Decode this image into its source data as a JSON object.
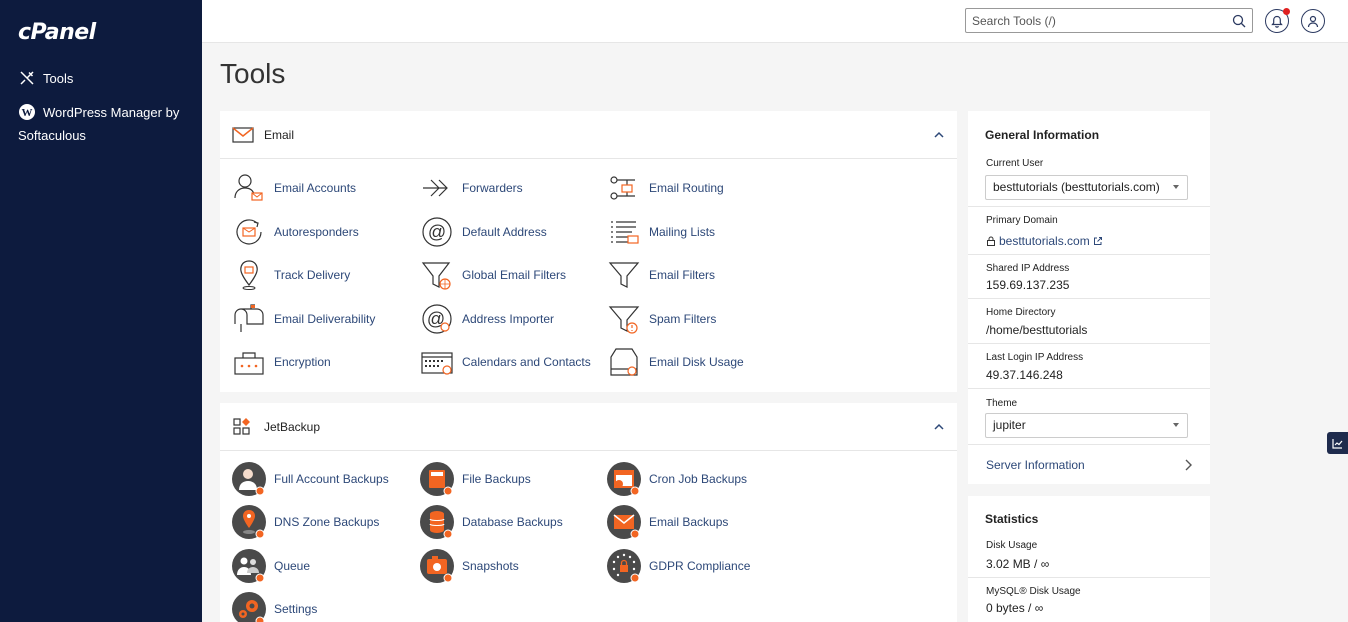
{
  "brand": {
    "logo": "cPanel"
  },
  "sidebar": {
    "items": [
      {
        "label": "Tools",
        "icon": "tools-icon"
      },
      {
        "label": "WordPress Manager by Softaculous",
        "icon": "wordpress-icon"
      }
    ]
  },
  "header": {
    "search_placeholder": "Search Tools (/)",
    "notification_dot_color": "#e02020"
  },
  "page": {
    "title": "Tools"
  },
  "email": {
    "title": "Email",
    "tools": [
      {
        "label": "Email Accounts",
        "icon": "email-accounts-icon"
      },
      {
        "label": "Forwarders",
        "icon": "forwarders-icon"
      },
      {
        "label": "Email Routing",
        "icon": "email-routing-icon"
      },
      {
        "label": "Autoresponders",
        "icon": "autoresponders-icon"
      },
      {
        "label": "Default Address",
        "icon": "default-address-icon"
      },
      {
        "label": "Mailing Lists",
        "icon": "mailing-lists-icon"
      },
      {
        "label": "Track Delivery",
        "icon": "track-delivery-icon"
      },
      {
        "label": "Global Email Filters",
        "icon": "global-email-filters-icon"
      },
      {
        "label": "Email Filters",
        "icon": "email-filters-icon"
      },
      {
        "label": "Email Deliverability",
        "icon": "email-deliverability-icon"
      },
      {
        "label": "Address Importer",
        "icon": "address-importer-icon"
      },
      {
        "label": "Spam Filters",
        "icon": "spam-filters-icon"
      },
      {
        "label": "Encryption",
        "icon": "encryption-icon"
      },
      {
        "label": "Calendars and Contacts",
        "icon": "calendars-contacts-icon"
      },
      {
        "label": "Email Disk Usage",
        "icon": "email-disk-usage-icon"
      }
    ]
  },
  "jetbackup": {
    "title": "JetBackup",
    "tools": [
      {
        "label": "Full Account Backups",
        "icon": "full-account-backups-icon"
      },
      {
        "label": "File Backups",
        "icon": "file-backups-icon"
      },
      {
        "label": "Cron Job Backups",
        "icon": "cron-job-backups-icon"
      },
      {
        "label": "DNS Zone Backups",
        "icon": "dns-zone-backups-icon"
      },
      {
        "label": "Database Backups",
        "icon": "database-backups-icon"
      },
      {
        "label": "Email Backups",
        "icon": "email-backups-icon"
      },
      {
        "label": "Queue",
        "icon": "queue-icon"
      },
      {
        "label": "Snapshots",
        "icon": "snapshots-icon"
      },
      {
        "label": "GDPR Compliance",
        "icon": "gdpr-compliance-icon"
      },
      {
        "label": "Settings",
        "icon": "settings-icon"
      }
    ]
  },
  "general_info": {
    "title": "General Information",
    "current_user_label": "Current User",
    "current_user": "besttutorials (besttutorials.com)",
    "primary_domain_label": "Primary Domain",
    "primary_domain": "besttutorials.com",
    "shared_ip_label": "Shared IP Address",
    "shared_ip": "159.69.137.235",
    "home_dir_label": "Home Directory",
    "home_dir": "/home/besttutorials",
    "last_login_label": "Last Login IP Address",
    "last_login_ip": "49.37.146.248",
    "theme_label": "Theme",
    "theme": "jupiter",
    "server_info": "Server Information"
  },
  "statistics": {
    "title": "Statistics",
    "disk_usage_label": "Disk Usage",
    "disk_usage": "3.02 MB / ∞",
    "mysql_label": "MySQL® Disk Usage",
    "mysql": "0 bytes / ∞"
  },
  "colors": {
    "sidebar": "#0d1b3e",
    "accent": "#f26522",
    "link": "#2d4878"
  }
}
